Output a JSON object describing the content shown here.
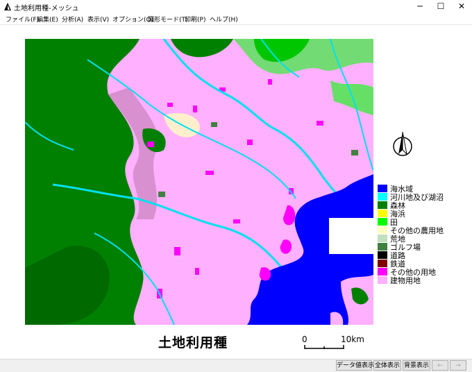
{
  "window": {
    "title": "土地利用種-メッシュ",
    "minimize_glyph": "─",
    "maximize_glyph": "☐",
    "close_glyph": "✕",
    "icon": "sail-app-icon"
  },
  "menu": [
    "ファイル(F)",
    "編集(E)",
    "分析(A)",
    "表示(V)",
    "オプション(O)",
    "図形モード(T)",
    "印刷(P)",
    "ヘルプ(H)"
  ],
  "map": {
    "title": "土地利用種",
    "scale": {
      "start_label": "0",
      "end_label": "10km"
    },
    "north_arrow": "north-arrow-icon"
  },
  "legend": [
    {
      "label": "海水域",
      "color": "#0000ff"
    },
    {
      "label": "河川地及び湖沼",
      "color": "#00ffff"
    },
    {
      "label": "森林",
      "color": "#008000"
    },
    {
      "label": "海浜",
      "color": "#ffff00"
    },
    {
      "label": "田",
      "color": "#00ff00"
    },
    {
      "label": "その他の農用地",
      "color": "#ffffc0"
    },
    {
      "label": "荒地",
      "color": "#c0e0c0"
    },
    {
      "label": "ゴルフ場",
      "color": "#408040"
    },
    {
      "label": "道路",
      "color": "#000000"
    },
    {
      "label": "鉄道",
      "color": "#800000"
    },
    {
      "label": "その他の用地",
      "color": "#ff00ff"
    },
    {
      "label": "建物用地",
      "color": "#ffb0ff"
    }
  ],
  "status_buttons": [
    "データ値表示",
    "全体表示",
    "背景表示",
    "←",
    "→"
  ]
}
